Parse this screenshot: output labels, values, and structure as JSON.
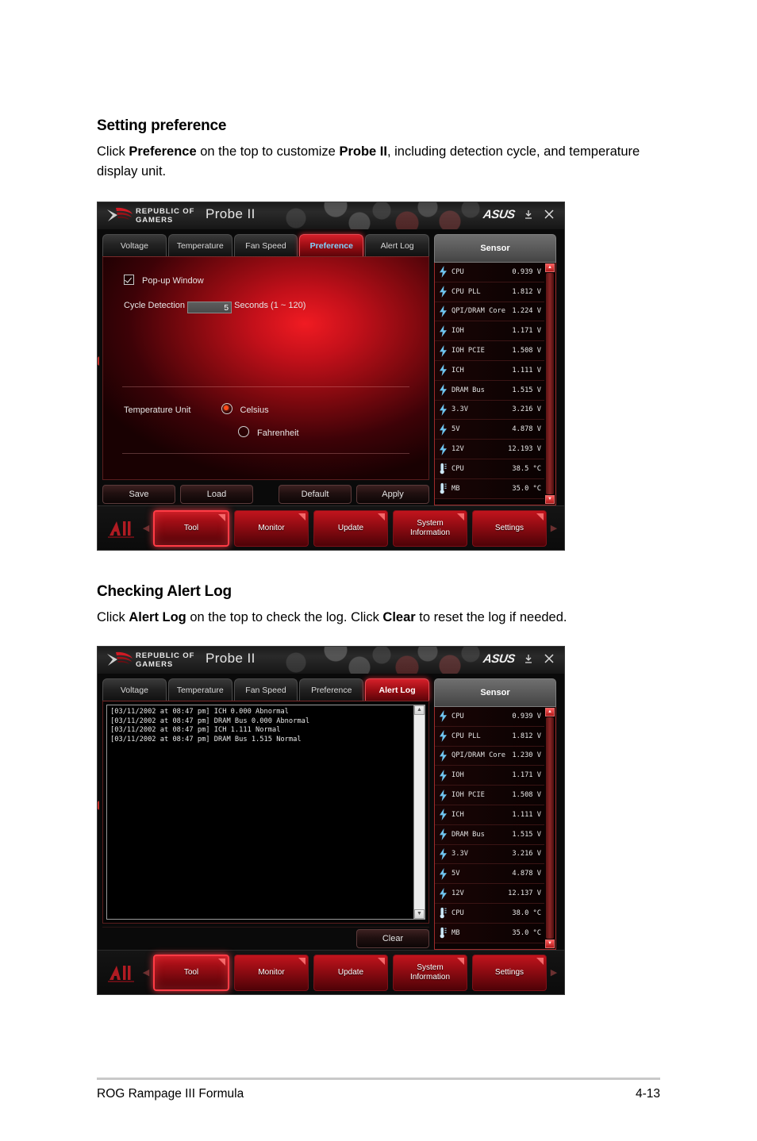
{
  "document": {
    "section1": {
      "heading": "Setting preference",
      "body_pre": "Click ",
      "body_b1": "Preference",
      "body_mid": " on the top to customize ",
      "body_b2": "Probe II",
      "body_post": ", including detection cycle, and temperature display unit."
    },
    "section2": {
      "heading": "Checking Alert Log",
      "body_pre": "Click ",
      "body_b1": "Alert Log",
      "body_mid": " on the top to check the log. Click ",
      "body_b2": "Clear",
      "body_post": " to reset the log if needed."
    },
    "footer": {
      "left": "ROG Rampage III Formula",
      "right": "4-13"
    }
  },
  "window1": {
    "titlebar": {
      "brand_line1": "REPUBLIC OF",
      "brand_line2": "GAMERS",
      "app_title": "Probe II",
      "vendor_logo": "ASUS",
      "minimize_icon": "minimize-icon",
      "close_icon": "close-icon",
      "rog_logo_icon": "rog-eye-logo-icon"
    },
    "tabs": [
      {
        "label": "Voltage",
        "active": false
      },
      {
        "label": "Temperature",
        "active": false
      },
      {
        "label": "Fan Speed",
        "active": false
      },
      {
        "label": "Preference",
        "active": true
      },
      {
        "label": "Alert Log",
        "active": false
      }
    ],
    "preference": {
      "popup_label": "Pop-up Window",
      "popup_checked": true,
      "cycle_label": "Cycle Detection",
      "cycle_value": "5",
      "cycle_suffix": "Seconds (1 ~ 120)",
      "temp_unit_label": "Temperature Unit",
      "options": [
        {
          "label": "Celsius",
          "selected": true
        },
        {
          "label": "Fahrenheit",
          "selected": false
        }
      ]
    },
    "actions": {
      "save": "Save",
      "load": "Load",
      "default": "Default",
      "apply": "Apply"
    },
    "sensor": {
      "title": "Sensor",
      "rows": [
        {
          "icon": "voltage-bolt-icon",
          "name": "CPU",
          "value": "0.939 V"
        },
        {
          "icon": "voltage-bolt-icon",
          "name": "CPU PLL",
          "value": "1.812 V"
        },
        {
          "icon": "voltage-bolt-icon",
          "name": "QPI/DRAM Core",
          "value": "1.224 V"
        },
        {
          "icon": "voltage-bolt-icon",
          "name": "IOH",
          "value": "1.171 V"
        },
        {
          "icon": "voltage-bolt-icon",
          "name": "IOH PCIE",
          "value": "1.508 V"
        },
        {
          "icon": "voltage-bolt-icon",
          "name": "ICH",
          "value": "1.111 V"
        },
        {
          "icon": "voltage-bolt-icon",
          "name": "DRAM Bus",
          "value": "1.515 V"
        },
        {
          "icon": "voltage-bolt-icon",
          "name": "3.3V",
          "value": "3.216 V"
        },
        {
          "icon": "voltage-bolt-icon",
          "name": "5V",
          "value": "4.878 V"
        },
        {
          "icon": "voltage-bolt-icon",
          "name": "12V",
          "value": "12.193 V"
        },
        {
          "icon": "thermometer-icon",
          "name": "CPU",
          "value": "38.5 °C"
        },
        {
          "icon": "thermometer-icon",
          "name": "MB",
          "value": "35.0 °C"
        }
      ]
    },
    "navbar": {
      "logo": "ai-suite-logo-icon",
      "prev_arrow": "◀",
      "next_arrow": "▶",
      "buttons": [
        {
          "label": "Tool",
          "selected": true
        },
        {
          "label": "Monitor",
          "selected": false
        },
        {
          "label": "Update",
          "selected": false
        },
        {
          "label": "System Information",
          "selected": false
        },
        {
          "label": "Settings",
          "selected": false
        }
      ]
    }
  },
  "window2": {
    "titlebar": {
      "brand_line1": "REPUBLIC OF",
      "brand_line2": "GAMERS",
      "app_title": "Probe II",
      "vendor_logo": "ASUS",
      "minimize_icon": "minimize-icon",
      "close_icon": "close-icon",
      "rog_logo_icon": "rog-eye-logo-icon"
    },
    "tabs": [
      {
        "label": "Voltage",
        "active": false
      },
      {
        "label": "Temperature",
        "active": false
      },
      {
        "label": "Fan Speed",
        "active": false
      },
      {
        "label": "Preference",
        "active": false
      },
      {
        "label": "Alert Log",
        "active": true
      }
    ],
    "alert_log": {
      "entries": [
        "[03/11/2002 at 08:47 pm] ICH 0.000 Abnormal",
        "[03/11/2002 at 08:47 pm] DRAM Bus 0.000 Abnormal",
        "[03/11/2002 at 08:47 pm] ICH 1.111 Normal",
        "[03/11/2002 at 08:47 pm] DRAM Bus 1.515 Normal"
      ],
      "clear_label": "Clear"
    },
    "sensor": {
      "title": "Sensor",
      "rows": [
        {
          "icon": "voltage-bolt-icon",
          "name": "CPU",
          "value": "0.939 V"
        },
        {
          "icon": "voltage-bolt-icon",
          "name": "CPU PLL",
          "value": "1.812 V"
        },
        {
          "icon": "voltage-bolt-icon",
          "name": "QPI/DRAM Core",
          "value": "1.230 V"
        },
        {
          "icon": "voltage-bolt-icon",
          "name": "IOH",
          "value": "1.171 V"
        },
        {
          "icon": "voltage-bolt-icon",
          "name": "IOH PCIE",
          "value": "1.508 V"
        },
        {
          "icon": "voltage-bolt-icon",
          "name": "ICH",
          "value": "1.111 V"
        },
        {
          "icon": "voltage-bolt-icon",
          "name": "DRAM Bus",
          "value": "1.515 V"
        },
        {
          "icon": "voltage-bolt-icon",
          "name": "3.3V",
          "value": "3.216 V"
        },
        {
          "icon": "voltage-bolt-icon",
          "name": "5V",
          "value": "4.878 V"
        },
        {
          "icon": "voltage-bolt-icon",
          "name": "12V",
          "value": "12.137 V"
        },
        {
          "icon": "thermometer-icon",
          "name": "CPU",
          "value": "38.0 °C"
        },
        {
          "icon": "thermometer-icon",
          "name": "MB",
          "value": "35.0 °C"
        }
      ]
    },
    "navbar": {
      "logo": "ai-suite-logo-icon",
      "prev_arrow": "◀",
      "next_arrow": "▶",
      "buttons": [
        {
          "label": "Tool",
          "selected": true
        },
        {
          "label": "Monitor",
          "selected": false
        },
        {
          "label": "Update",
          "selected": false
        },
        {
          "label": "System Information",
          "selected": false
        },
        {
          "label": "Settings",
          "selected": false
        }
      ]
    }
  },
  "colors": {
    "accent_red": "#c2141d",
    "tab_active": "#d4202a",
    "panel_red": "#f01b22",
    "sensor_header": "#5a5a5a"
  }
}
